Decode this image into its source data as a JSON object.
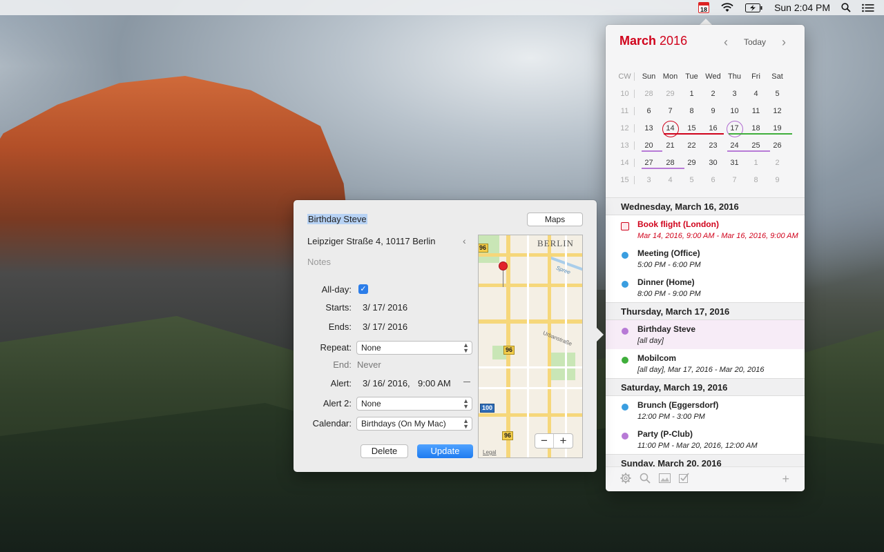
{
  "menubar": {
    "calendar_icon_day": "18",
    "clock": "Sun 2:04 PM",
    "icons": [
      "calendar-icon",
      "wifi-icon",
      "battery-charging-icon",
      "spotlight-search-icon",
      "notification-center-icon"
    ]
  },
  "calendar": {
    "month": "March",
    "year": "2016",
    "today_label": "Today",
    "header": [
      "CW",
      "Sun",
      "Mon",
      "Tue",
      "Wed",
      "Thu",
      "Fri",
      "Sat"
    ],
    "weeks": [
      {
        "cw": "10",
        "days": [
          "28",
          "29",
          "1",
          "2",
          "3",
          "4",
          "5"
        ]
      },
      {
        "cw": "11",
        "days": [
          "6",
          "7",
          "8",
          "9",
          "10",
          "11",
          "12"
        ]
      },
      {
        "cw": "12",
        "days": [
          "13",
          "14",
          "15",
          "16",
          "17",
          "18",
          "19"
        ]
      },
      {
        "cw": "13",
        "days": [
          "20",
          "21",
          "22",
          "23",
          "24",
          "25",
          "26"
        ]
      },
      {
        "cw": "14",
        "days": [
          "27",
          "28",
          "29",
          "30",
          "31",
          "1",
          "2"
        ]
      },
      {
        "cw": "15",
        "days": [
          "3",
          "4",
          "5",
          "6",
          "7",
          "8",
          "9"
        ]
      }
    ],
    "today_circle_color": "#d0021b",
    "selected_circle_color": "#b06ad0"
  },
  "agenda": [
    {
      "day": "Wednesday, March 16, 2016",
      "events": [
        {
          "title": "Book flight (London)",
          "time": "Mar 14, 2016, 9:00 AM - Mar 16, 2016, 9:00 AM",
          "color": "#d0021b",
          "kind": "task"
        },
        {
          "title": "Meeting (Office)",
          "time": "5:00 PM - 6:00 PM",
          "color": "#3a9ee0",
          "kind": "event"
        },
        {
          "title": "Dinner (Home)",
          "time": "8:00 PM - 9:00 PM",
          "color": "#3a9ee0",
          "kind": "event"
        }
      ]
    },
    {
      "day": "Thursday, March 17, 2016",
      "events": [
        {
          "title": "Birthday Steve",
          "time": "[all day]",
          "color": "#b77ad6",
          "kind": "event",
          "selected": true
        },
        {
          "title": "Mobilcom",
          "time": "[all day], Mar 17, 2016 - Mar 20, 2016",
          "color": "#3fae3b",
          "kind": "event"
        }
      ]
    },
    {
      "day": "Saturday, March 19, 2016",
      "events": [
        {
          "title": "Brunch (Eggersdorf)",
          "time": "12:00 PM - 3:00 PM",
          "color": "#3a9ee0",
          "kind": "event"
        },
        {
          "title": "Party (P-Club)",
          "time": "11:00 PM - Mar 20, 2016, 12:00 AM",
          "color": "#b77ad6",
          "kind": "event"
        }
      ]
    },
    {
      "day": "Sunday, March 20, 2016",
      "events": []
    }
  ],
  "toolbar": {
    "icons": [
      "gear-icon",
      "search-icon",
      "image-icon",
      "checkbox-icon"
    ],
    "add": "+"
  },
  "editor": {
    "title": "Birthday Steve",
    "maps_label": "Maps",
    "address": "Leipziger Straße 4, 10117 Berlin",
    "notes_placeholder": "Notes",
    "allday_label": "All-day:",
    "allday_checked": true,
    "starts_label": "Starts:",
    "starts_value": "3/ 17/ 2016",
    "ends_label": "Ends:",
    "ends_value": "3/ 17/ 2016",
    "repeat_label": "Repeat:",
    "repeat_value": "None",
    "end_label": "End:",
    "end_value": "Never",
    "alert_label": "Alert:",
    "alert_date": "3/ 16/ 2016,",
    "alert_time": "9:00 AM",
    "alert2_label": "Alert 2:",
    "alert2_value": "None",
    "calendar_label": "Calendar:",
    "calendar_value": "Birthdays (On My Mac)",
    "delete_label": "Delete",
    "update_label": "Update"
  },
  "map": {
    "city_label": "BERLIN",
    "river_label": "Spree",
    "street_label": "Urbanstraße",
    "route_shields": [
      "96",
      "96",
      "96",
      "100"
    ],
    "zoom_out": "−",
    "zoom_in": "+",
    "legal": "Legal"
  }
}
